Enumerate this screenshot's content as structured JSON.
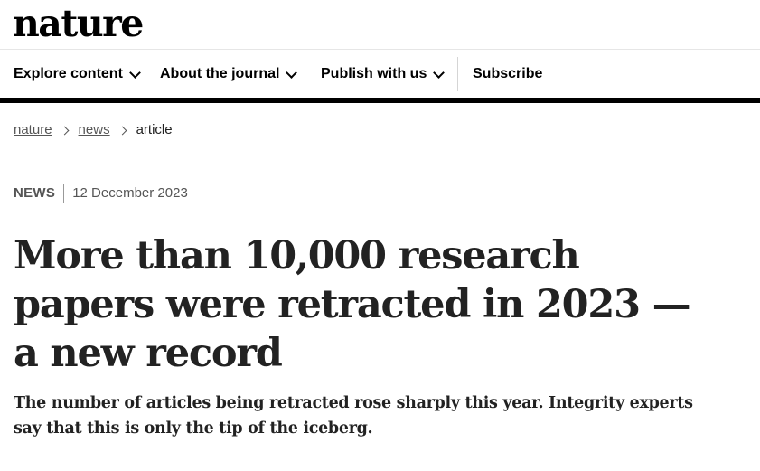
{
  "header": {
    "logo_text": "nature"
  },
  "nav": {
    "items": [
      {
        "label": "Explore content",
        "has_dropdown": true
      },
      {
        "label": "About the journal",
        "has_dropdown": true
      },
      {
        "label": "Publish with us",
        "has_dropdown": true
      }
    ],
    "subscribe_label": "Subscribe"
  },
  "breadcrumb": [
    {
      "label": "nature",
      "link": true
    },
    {
      "label": "news",
      "link": true
    },
    {
      "label": "article",
      "link": false
    }
  ],
  "article": {
    "type": "NEWS",
    "date": "12 December 2023",
    "title": "More than 10,000 research papers were retracted in 2023 — a new record",
    "standfirst": "The number of articles being retracted rose sharply this year. Integrity experts say that this is only the tip of the iceberg."
  }
}
